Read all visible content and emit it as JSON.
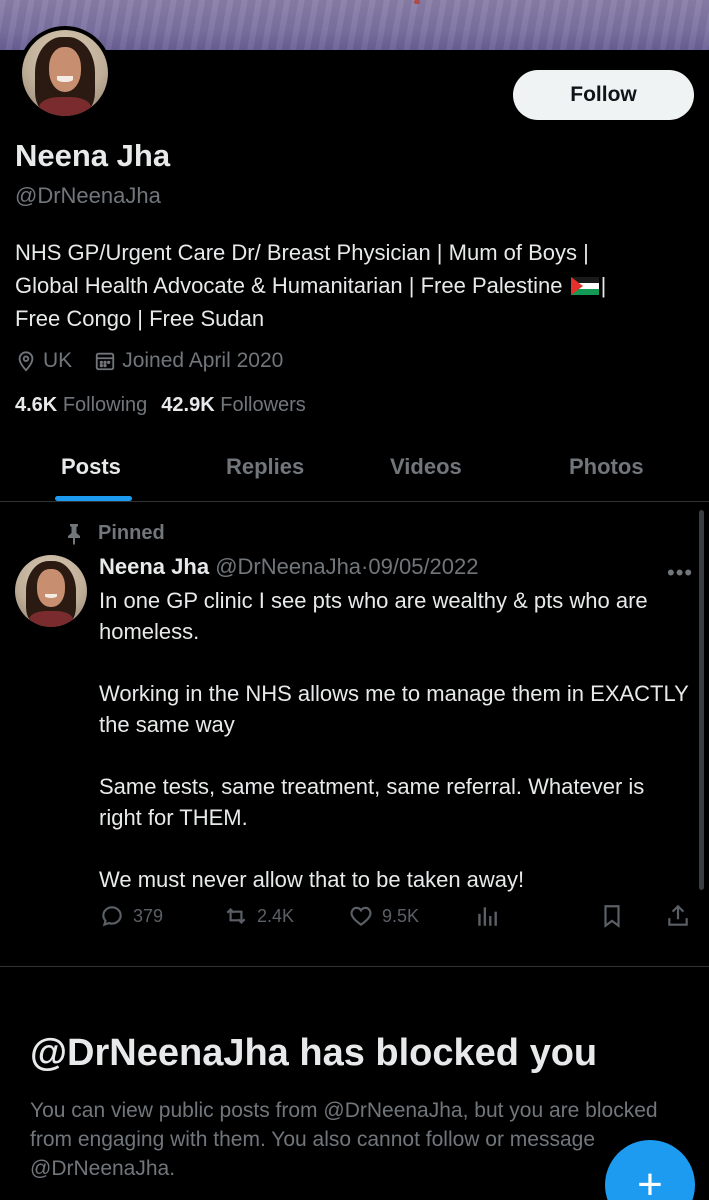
{
  "profile": {
    "name": "Neena Jha",
    "handle": "@DrNeenaJha",
    "follow_label": "Follow",
    "bio_lines": [
      "NHS GP/Urgent Care Dr/ Breast Physician | Mum of Boys |",
      "Global Health Advocate & Humanitarian | Free Palestine",
      "|",
      "Free Congo | Free Sudan"
    ],
    "location": "UK",
    "joined": "Joined April 2020",
    "following_count": "4.6K",
    "following_label": "Following",
    "followers_count": "42.9K",
    "followers_label": "Followers"
  },
  "tabs": [
    {
      "label": "Posts",
      "active": true
    },
    {
      "label": "Replies",
      "active": false
    },
    {
      "label": "Videos",
      "active": false
    },
    {
      "label": "Photos",
      "active": false
    }
  ],
  "pinned_post": {
    "pinned_label": "Pinned",
    "author_name": "Neena Jha",
    "author_handle": "@DrNeenaJha",
    "separator": "·",
    "date": "09/05/2022",
    "more_label": "•••",
    "paragraphs": [
      "In one GP clinic I see pts who are wealthy & pts who are homeless.",
      "Working in the NHS allows me to manage them in EXACTLY the same way",
      "Same tests, same treatment, same referral. Whatever is right for THEM.",
      "We must never allow that to be taken away!"
    ],
    "replies": "379",
    "reposts": "2.4K",
    "likes": "9.5K"
  },
  "blocked": {
    "title": "@DrNeenaJha has blocked you",
    "message": "You can view public posts from @DrNeenaJha, but you are blocked from engaging with them. You also cannot follow or message @DrNeenaJha."
  },
  "fab": {
    "label": "+"
  },
  "colors": {
    "background": "#000000",
    "text_primary": "#e7e9ea",
    "text_secondary": "#71767b",
    "accent": "#1d9bf0",
    "divider": "#2f3336"
  },
  "icons": [
    "location-icon",
    "calendar-icon",
    "pin-icon",
    "reply-icon",
    "repost-icon",
    "like-icon",
    "views-icon",
    "bookmark-icon",
    "share-icon",
    "palestine-flag-icon"
  ]
}
